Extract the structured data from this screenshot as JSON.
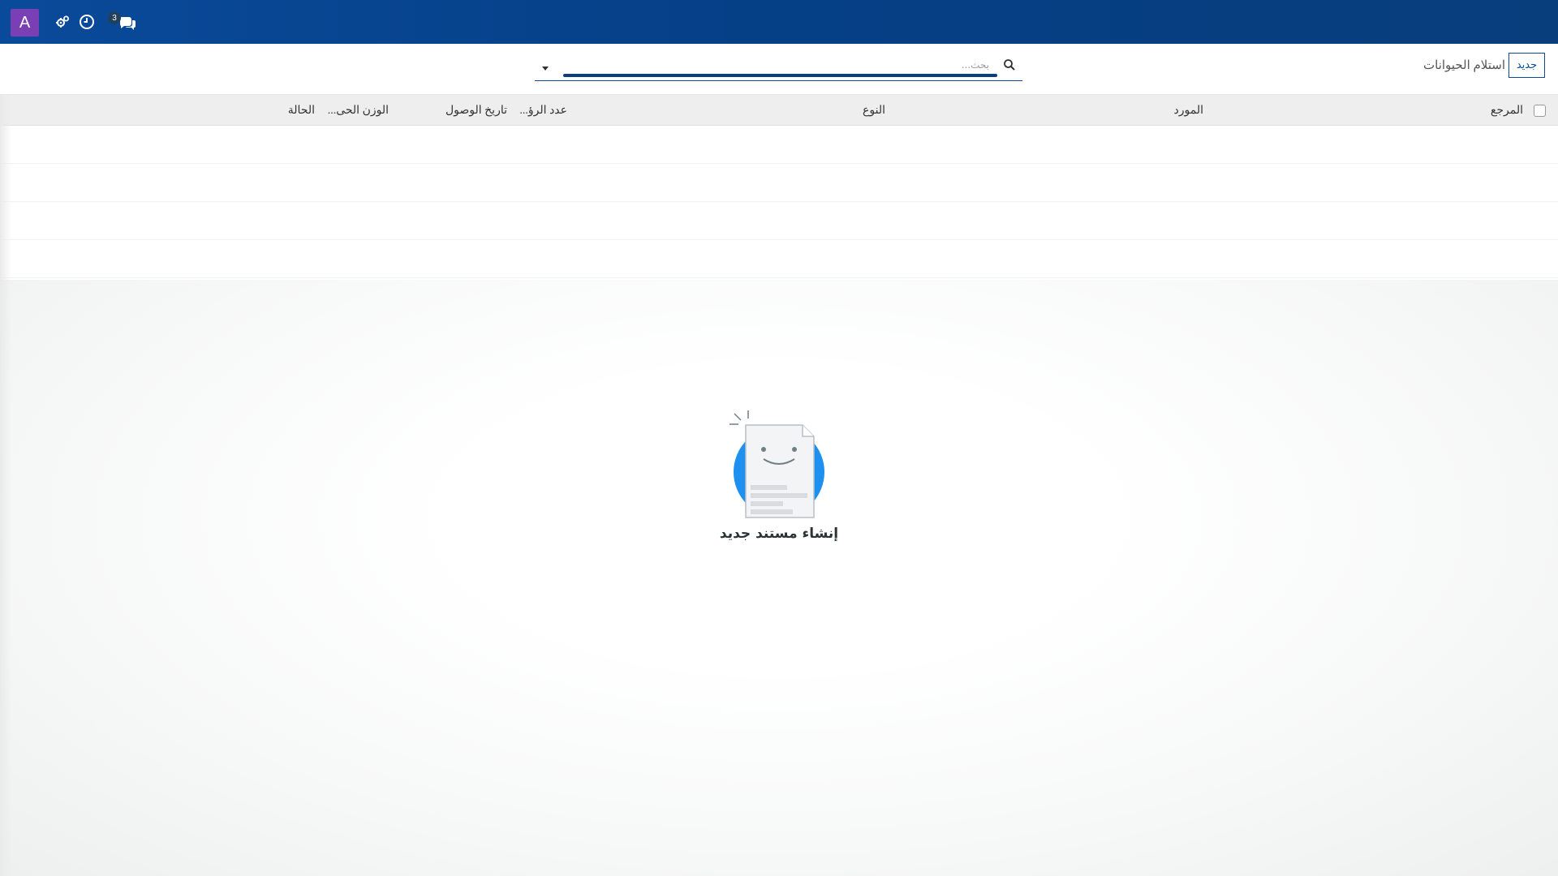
{
  "topbar": {
    "avatar_letter": "A",
    "avatar_color": "#7b3fb5",
    "icons": [
      "settings-icon",
      "clock-icon",
      "chat-icon"
    ],
    "chat_badge_count": "3"
  },
  "controlbar": {
    "new_label": "جديد",
    "breadcrumb": "استلام الحيوانات",
    "search": {
      "placeholder": "بحث..."
    }
  },
  "table": {
    "columns": [
      "المرجع",
      "المورد",
      "النوع",
      "عدد الرؤ...",
      "تاريخ الوصول",
      "الوزن الحى...",
      "الحالة"
    ],
    "rows": []
  },
  "empty_state": {
    "title": "إنشاء مستند جديد"
  },
  "colors": {
    "topbar": "#0a4a9a",
    "accent": "#0a4a9a",
    "illustration_circle": "#1e90ef"
  }
}
